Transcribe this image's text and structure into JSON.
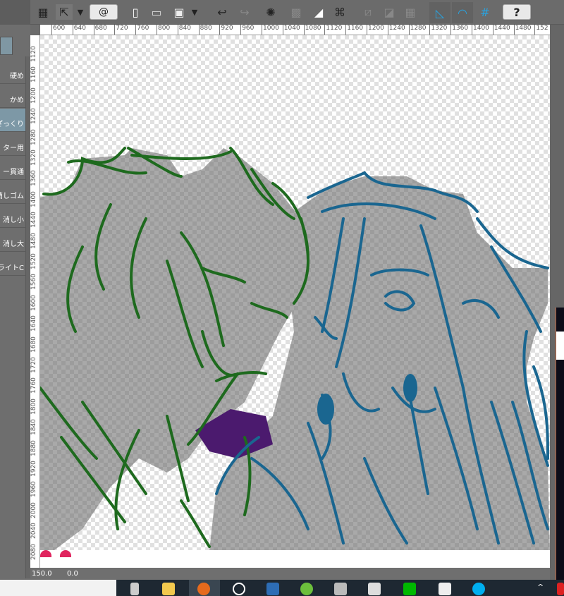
{
  "left_panel": {
    "tools": [
      {
        "label": "硬め",
        "selected": false
      },
      {
        "label": "かめ",
        "selected": false
      },
      {
        "label": "ざっくり",
        "selected": true
      },
      {
        "label": "ター用",
        "selected": false
      },
      {
        "label": "ー貫通",
        "selected": false
      },
      {
        "label": "消しゴム",
        "selected": false
      },
      {
        "label": "消し小",
        "selected": false
      },
      {
        "label": "消し大",
        "selected": false
      },
      {
        "label": "ライトC",
        "selected": false
      }
    ]
  },
  "toolbar": {
    "icons": [
      "grid-icon",
      "move-layer-icon",
      "dropdown-icon",
      "clip-logo-icon",
      "new-file-icon",
      "open-folder-icon",
      "save-icon",
      "dropdown-icon",
      "undo-icon",
      "redo-icon",
      "loading-icon",
      "crop-icon",
      "fill-icon",
      "transform-icon",
      "clear-selection-icon",
      "invert-selection-icon",
      "select-border-icon",
      "ruler-snap-icon",
      "special-ruler-snap-icon",
      "grid-snap-icon",
      "help-icon"
    ]
  },
  "ruler": {
    "top": [
      "600",
      "640",
      "680",
      "720",
      "760",
      "800",
      "840",
      "880",
      "920",
      "960",
      "1000",
      "1040",
      "1080",
      "1120",
      "1160",
      "1200",
      "1240",
      "1280",
      "1320",
      "1360",
      "1400",
      "1440",
      "1480",
      "152"
    ],
    "left": [
      "1120",
      "1160",
      "1200",
      "1240",
      "1280",
      "1320",
      "1360",
      "1400",
      "1440",
      "1480",
      "1520",
      "1560",
      "1600",
      "1640",
      "1680",
      "1720",
      "1760",
      "1800",
      "1840",
      "1880",
      "1920",
      "1960",
      "2000",
      "2040",
      "2080"
    ]
  },
  "colors": {
    "green_line": "#1e6a1e",
    "blue_line": "#1a6690",
    "purple_fill": "#4b1a6e",
    "accent_blue": "#29a3e0"
  },
  "status": {
    "zoom": "150.0",
    "angle": "0.0"
  }
}
